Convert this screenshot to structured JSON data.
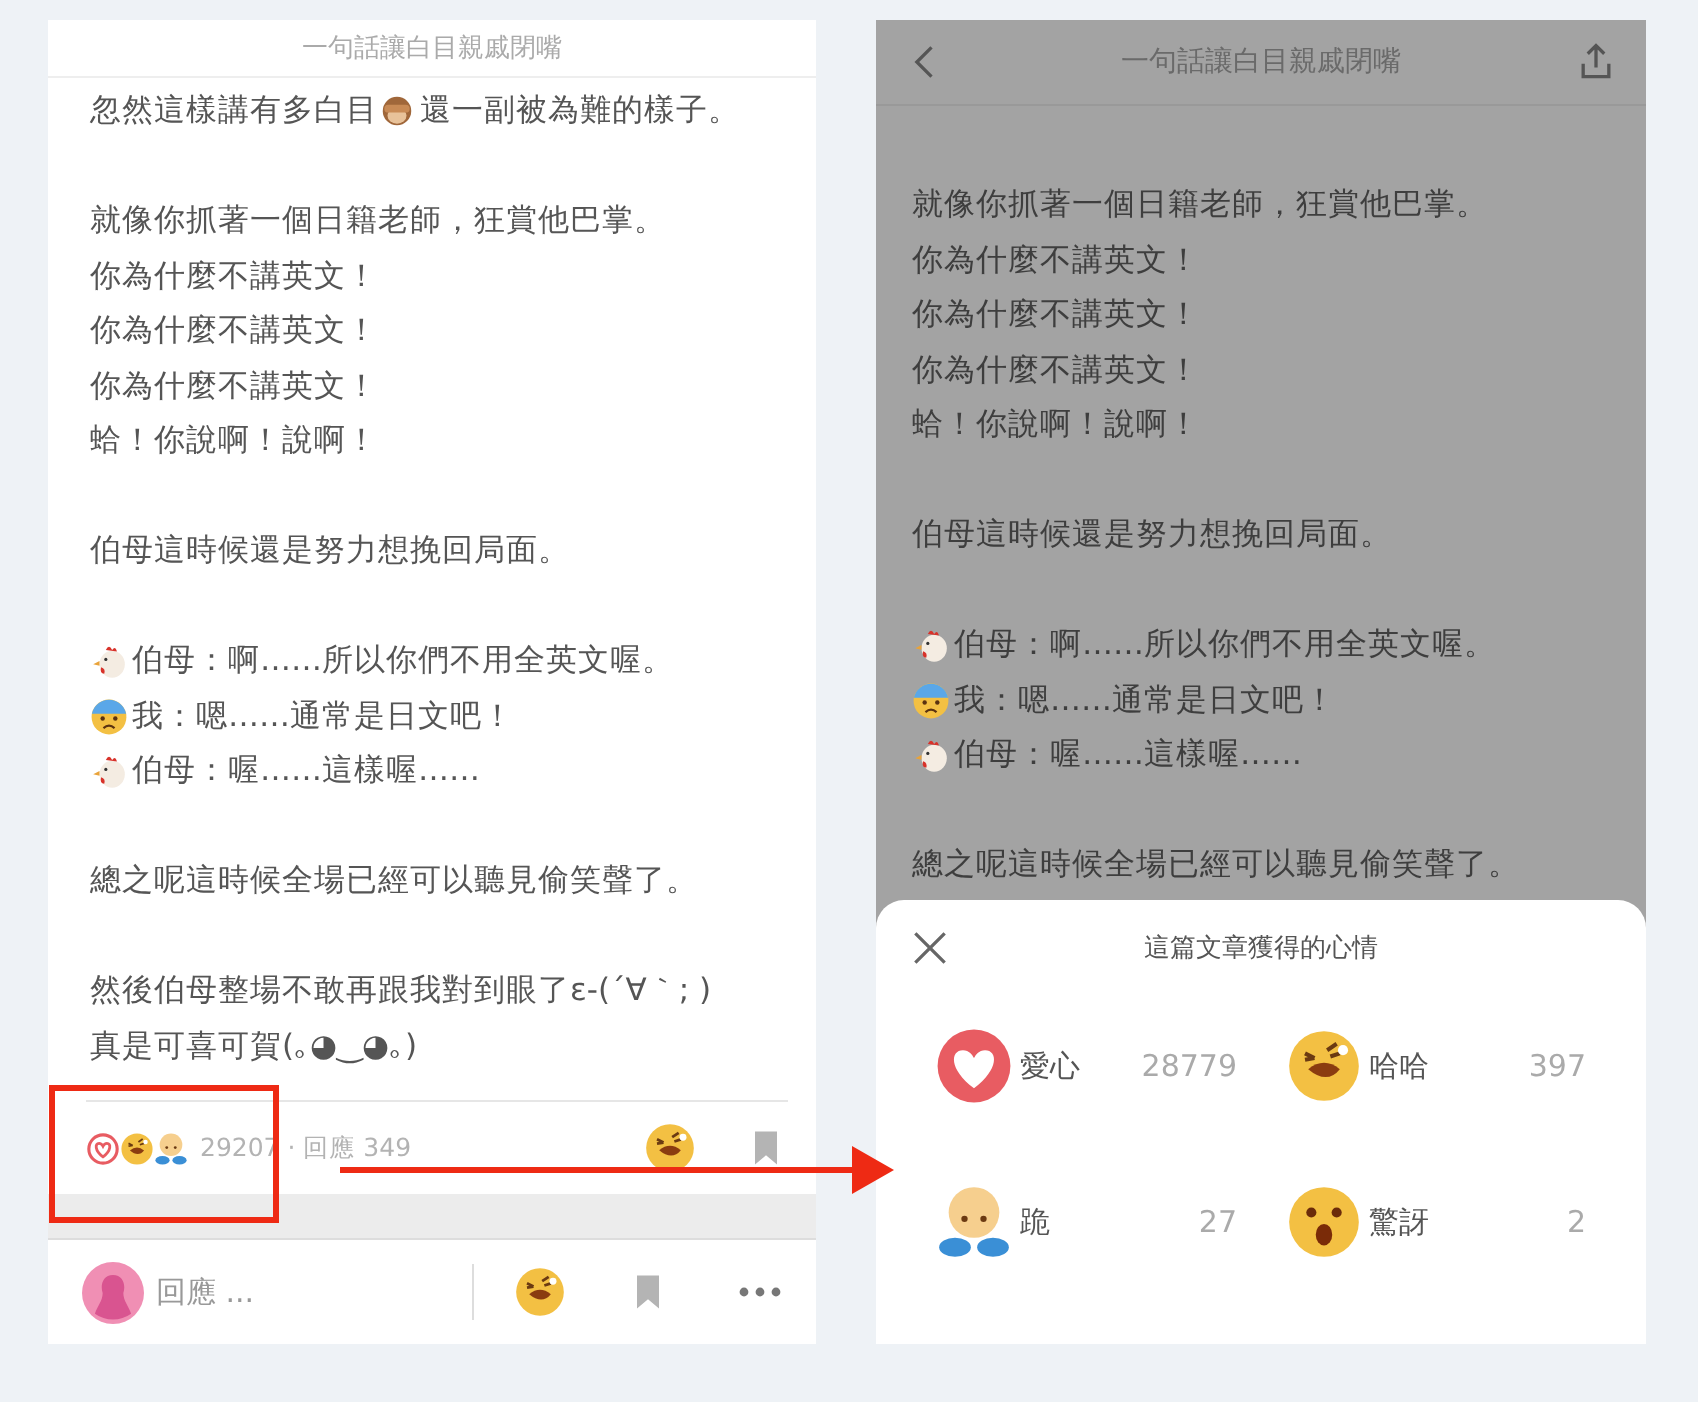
{
  "left_screen": {
    "title": "一句話讓白目親戚閉嘴",
    "paragraphs": [
      [
        {
          "kind": "emoji_inline",
          "text": "忽然這樣講有多白目",
          "text_after": "還一副被為難的樣子。"
        }
      ],
      [
        {
          "kind": "plain",
          "text": "就像你抓著一個日籍老師，狂賞他巴掌。"
        },
        {
          "kind": "plain",
          "text": "你為什麼不講英文！"
        },
        {
          "kind": "plain",
          "text": "你為什麼不講英文！"
        },
        {
          "kind": "plain",
          "text": "你為什麼不講英文！"
        },
        {
          "kind": "plain",
          "text": "蛤！你說啊！說啊！"
        }
      ],
      [
        {
          "kind": "plain",
          "text": "伯母這時候還是努力想挽回局面。"
        }
      ],
      [
        {
          "kind": "aunt",
          "text": "伯母：啊……所以你們不用全英文喔。"
        },
        {
          "kind": "me",
          "text": "我：嗯……通常是日文吧！"
        },
        {
          "kind": "aunt",
          "text": "伯母：喔……這樣喔……"
        }
      ],
      [
        {
          "kind": "plain",
          "text": "總之呢這時候全場已經可以聽見偷笑聲了。"
        }
      ],
      [
        {
          "kind": "plain",
          "text": "然後伯母整場不敢再跟我對到眼了ε-(´∀｀; )"
        },
        {
          "kind": "plain",
          "text": "真是可喜可賀(｡◕‿◕｡)"
        }
      ]
    ],
    "reaction_icons": [
      {
        "kind": "heart"
      },
      {
        "kind": "laugh"
      },
      {
        "kind": "kneel"
      }
    ],
    "reaction_summary": "29207 · 回應 349",
    "quick_reaction": {
      "kind": "laugh"
    },
    "reply_placeholder": "回應 ..."
  },
  "right_screen": {
    "title": "一句話讓白目親戚閉嘴",
    "paragraphs": [
      [
        {
          "kind": "plain",
          "text": "就像你抓著一個日籍老師，狂賞他巴掌。"
        },
        {
          "kind": "plain",
          "text": "你為什麼不講英文！"
        },
        {
          "kind": "plain",
          "text": "你為什麼不講英文！"
        },
        {
          "kind": "plain",
          "text": "你為什麼不講英文！"
        },
        {
          "kind": "plain",
          "text": "蛤！你說啊！說啊！"
        }
      ],
      [
        {
          "kind": "plain",
          "text": "伯母這時候還是努力想挽回局面。"
        }
      ],
      [
        {
          "kind": "aunt",
          "text": "伯母：啊……所以你們不用全英文喔。"
        },
        {
          "kind": "me",
          "text": "我：嗯……通常是日文吧！"
        },
        {
          "kind": "aunt",
          "text": "伯母：喔……這樣喔……"
        }
      ],
      [
        {
          "kind": "plain",
          "text": "總之呢這時候全場已經可以聽見偷笑聲了。"
        }
      ]
    ],
    "sheet": {
      "title": "這篇文章獲得的心情",
      "reactions": [
        {
          "kind": "heart",
          "label": "愛心",
          "count": "28779"
        },
        {
          "kind": "laugh",
          "label": "哈哈",
          "count": "397"
        },
        {
          "kind": "kneel",
          "label": "跪",
          "count": "27"
        },
        {
          "kind": "surprised",
          "label": "驚訝",
          "count": "2"
        }
      ]
    }
  }
}
